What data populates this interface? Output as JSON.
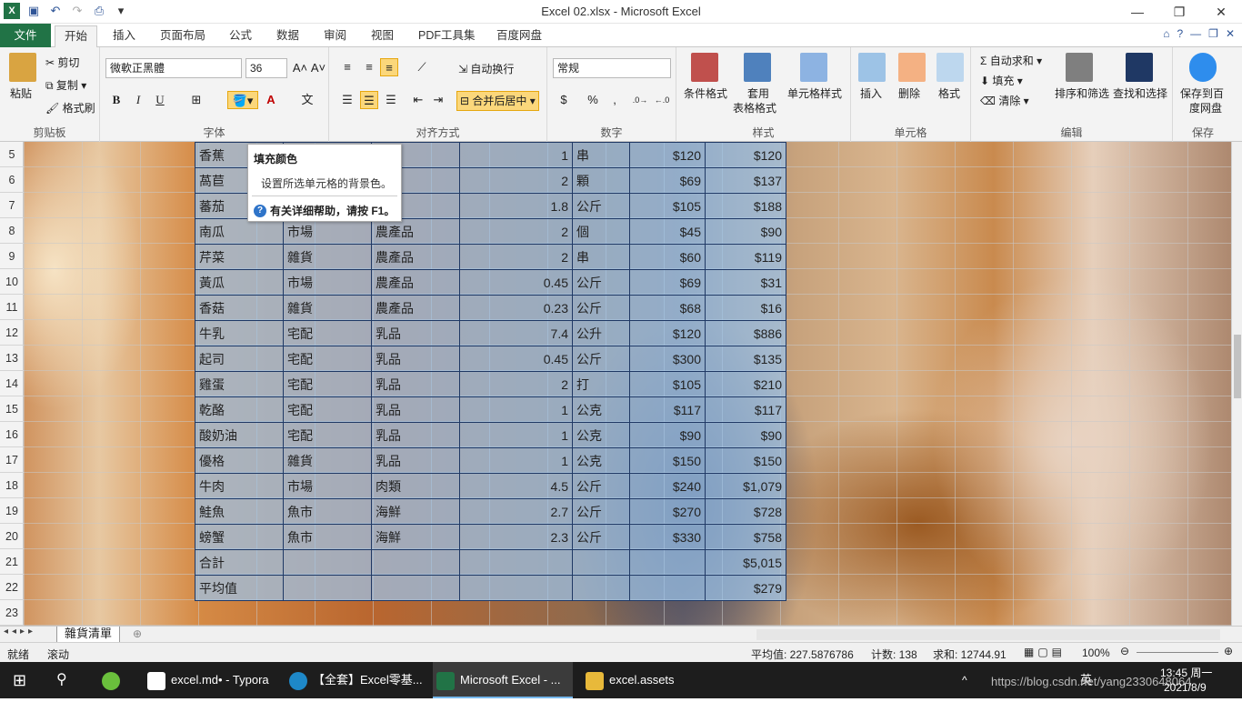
{
  "window": {
    "title": "Excel 02.xlsx  -  Microsoft Excel"
  },
  "tabs": [
    "文件",
    "开始",
    "插入",
    "页面布局",
    "公式",
    "数据",
    "审阅",
    "视图",
    "PDF工具集",
    "百度网盘"
  ],
  "ribbon": {
    "clipboard": {
      "paste": "粘贴",
      "cut": "剪切",
      "copy": "复制",
      "format_painter": "格式刷",
      "group": "剪贴板"
    },
    "font": {
      "name": "微軟正黑體",
      "size": "36",
      "bold": "B",
      "italic": "I",
      "underline": "U",
      "group": "字体"
    },
    "alignment": {
      "wrap": "自动换行",
      "merge": "合并后居中",
      "group": "对齐方式"
    },
    "number": {
      "format": "常规",
      "group": "数字"
    },
    "styles": {
      "cond": "条件格式",
      "table1": "套用",
      "table2": "表格格式",
      "cell": "单元格样式",
      "group": "样式"
    },
    "cells": {
      "insert": "插入",
      "delete": "删除",
      "format": "格式",
      "group": "单元格"
    },
    "editing": {
      "autosum": "自动求和",
      "fill": "填充",
      "clear": "清除",
      "sort": "排序和筛选",
      "find": "查找和选择",
      "group": "编辑"
    },
    "save": {
      "label1": "保存到百",
      "label2": "度网盘",
      "group": "保存"
    }
  },
  "tooltip": {
    "title": "填充颜色",
    "desc": "设置所选单元格的背景色。",
    "help": "有关详细帮助，请按 F1。"
  },
  "rows": [
    {
      "num": "5",
      "c": [
        "香蕉",
        "",
        "品",
        "1",
        "串",
        "$120",
        "$120"
      ]
    },
    {
      "num": "6",
      "c": [
        "萵苣",
        "",
        "品",
        "2",
        "顆",
        "$69",
        "$137"
      ]
    },
    {
      "num": "7",
      "c": [
        "蕃茄",
        "",
        "品",
        "1.8",
        "公斤",
        "$105",
        "$188"
      ]
    },
    {
      "num": "8",
      "c": [
        "南瓜",
        "市場",
        "農產品",
        "2",
        "個",
        "$45",
        "$90"
      ]
    },
    {
      "num": "9",
      "c": [
        "芹菜",
        "雜貨",
        "農產品",
        "2",
        "串",
        "$60",
        "$119"
      ]
    },
    {
      "num": "10",
      "c": [
        "黃瓜",
        "市場",
        "農產品",
        "0.45",
        "公斤",
        "$69",
        "$31"
      ]
    },
    {
      "num": "11",
      "c": [
        "香菇",
        "雜貨",
        "農產品",
        "0.23",
        "公斤",
        "$68",
        "$16"
      ]
    },
    {
      "num": "12",
      "c": [
        "牛乳",
        "宅配",
        "乳品",
        "7.4",
        "公升",
        "$120",
        "$886"
      ]
    },
    {
      "num": "13",
      "c": [
        "起司",
        "宅配",
        "乳品",
        "0.45",
        "公斤",
        "$300",
        "$135"
      ]
    },
    {
      "num": "14",
      "c": [
        "雞蛋",
        "宅配",
        "乳品",
        "2",
        "打",
        "$105",
        "$210"
      ]
    },
    {
      "num": "15",
      "c": [
        "乾酪",
        "宅配",
        "乳品",
        "1",
        "公克",
        "$117",
        "$117"
      ]
    },
    {
      "num": "16",
      "c": [
        "酸奶油",
        "宅配",
        "乳品",
        "1",
        "公克",
        "$90",
        "$90"
      ]
    },
    {
      "num": "17",
      "c": [
        "優格",
        "雜貨",
        "乳品",
        "1",
        "公克",
        "$150",
        "$150"
      ]
    },
    {
      "num": "18",
      "c": [
        "牛肉",
        "市場",
        "肉類",
        "4.5",
        "公斤",
        "$240",
        "$1,079"
      ]
    },
    {
      "num": "19",
      "c": [
        "鮭魚",
        "魚市",
        "海鮮",
        "2.7",
        "公斤",
        "$270",
        "$728"
      ]
    },
    {
      "num": "20",
      "c": [
        "螃蟹",
        "魚市",
        "海鮮",
        "2.3",
        "公斤",
        "$330",
        "$758"
      ]
    },
    {
      "num": "21",
      "c": [
        "合計",
        "",
        "",
        "",
        "",
        "",
        "$5,015"
      ]
    },
    {
      "num": "22",
      "c": [
        "平均值",
        "",
        "",
        "",
        "",
        "",
        "$279"
      ]
    }
  ],
  "row_last": "23",
  "sheet_tab": "雜貨清單",
  "status": {
    "ready": "就绪",
    "scroll": "滚动",
    "average": "平均值: 227.5876786",
    "count": "计数: 138",
    "sum": "求和: 12744.91",
    "zoom": "100%"
  },
  "taskbar": {
    "items": [
      "excel.md• - Typora",
      "【全套】Excel零基...",
      "Microsoft Excel - ...",
      "excel.assets"
    ],
    "time": "13:45 周一",
    "date": "2021/8/9",
    "ime": "英",
    "watermark": "https://blog.csdn.net/yang2330648064"
  },
  "colors": {
    "accent": "#217346",
    "table_fill": "#9cc5eb",
    "border": "#1f3864"
  }
}
